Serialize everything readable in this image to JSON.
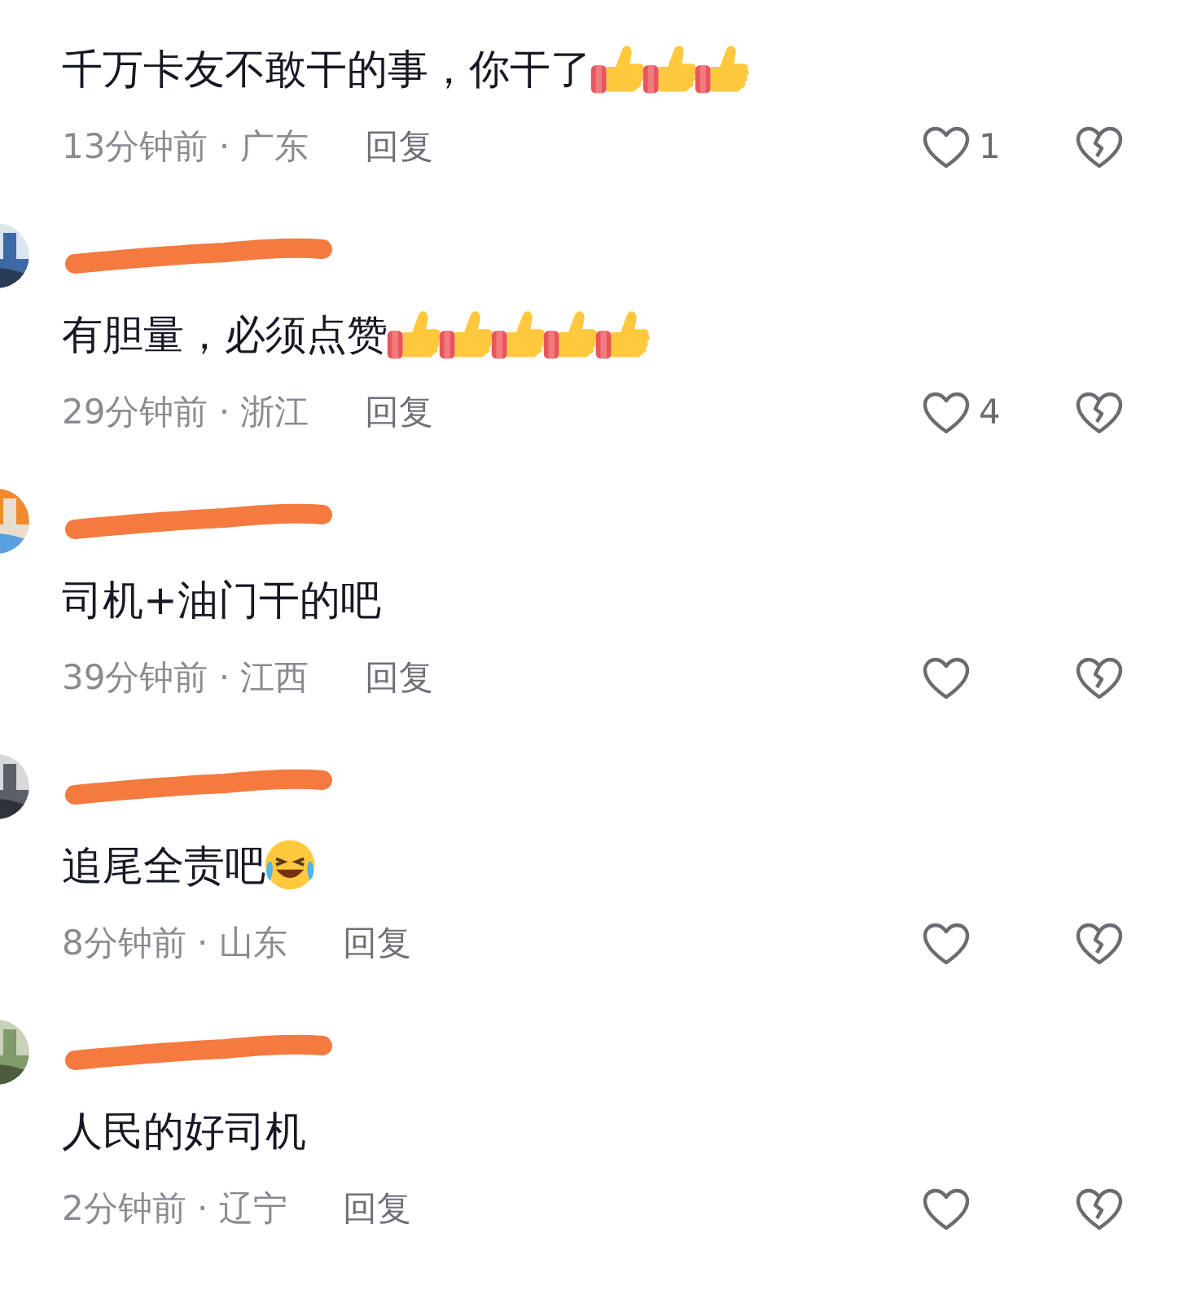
{
  "comments": [
    {
      "redacted_name": false,
      "avatar": false,
      "text": "千万卡友不敢干的事，你干了",
      "reactions": [
        {
          "kind": "thumbs_up"
        },
        {
          "kind": "thumbs_up"
        },
        {
          "kind": "thumbs_up"
        }
      ],
      "meta": "13分钟前 · 广东",
      "reply": "回复",
      "likes": "1"
    },
    {
      "redacted_name": true,
      "avatar": true,
      "text": "有胆量，必须点赞",
      "reactions": [
        {
          "kind": "thumbs_up"
        },
        {
          "kind": "thumbs_up"
        },
        {
          "kind": "thumbs_up"
        },
        {
          "kind": "thumbs_up"
        },
        {
          "kind": "thumbs_up"
        }
      ],
      "meta": "29分钟前 · 浙江",
      "reply": "回复",
      "likes": "4"
    },
    {
      "redacted_name": true,
      "avatar": true,
      "text": "司机+油门干的吧",
      "meta": "39分钟前 · 江西",
      "reply": "回复"
    },
    {
      "redacted_name": true,
      "avatar": true,
      "text": "追尾全责吧",
      "reactions": [
        {
          "kind": "laughing"
        }
      ],
      "meta": "8分钟前 · 山东",
      "reply": "回复"
    },
    {
      "redacted_name": true,
      "avatar": true,
      "text": "人民的好司机",
      "meta": "2分钟前 · 辽宁",
      "reply": "回复"
    }
  ]
}
